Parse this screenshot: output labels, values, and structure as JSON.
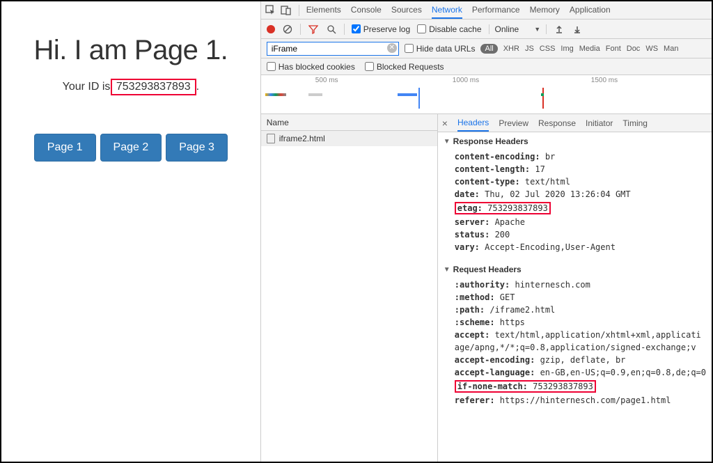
{
  "webpage": {
    "heading": "Hi. I am Page 1.",
    "id_label": "Your ID is ",
    "id_value": "753293837893",
    "id_suffix": ".",
    "buttons": [
      "Page 1",
      "Page 2",
      "Page 3"
    ]
  },
  "devtools": {
    "top_tabs": [
      "Elements",
      "Console",
      "Sources",
      "Network",
      "Performance",
      "Memory",
      "Application"
    ],
    "top_active": "Network",
    "toolbar": {
      "preserve_log": "Preserve log",
      "disable_cache": "Disable cache",
      "throttling": "Online"
    },
    "filter": {
      "value": "iFrame",
      "hide_data_urls": "Hide data URLs",
      "types": [
        "All",
        "XHR",
        "JS",
        "CSS",
        "Img",
        "Media",
        "Font",
        "Doc",
        "WS",
        "Man"
      ],
      "has_blocked": "Has blocked cookies",
      "blocked_req": "Blocked Requests"
    },
    "timeline": {
      "ticks": [
        "500 ms",
        "1000 ms",
        "1500 ms"
      ]
    },
    "list": {
      "col": "Name",
      "rows": [
        "iframe2.html"
      ]
    },
    "detail": {
      "tabs": [
        "Headers",
        "Preview",
        "Response",
        "Initiator",
        "Timing"
      ],
      "active": "Headers",
      "response_section": "Response Headers",
      "response_headers": [
        {
          "k": "content-encoding:",
          "v": "br"
        },
        {
          "k": "content-length:",
          "v": "17"
        },
        {
          "k": "content-type:",
          "v": "text/html"
        },
        {
          "k": "date:",
          "v": "Thu, 02 Jul 2020 13:26:04 GMT"
        },
        {
          "k": "etag:",
          "v": "753293837893",
          "hl": true
        },
        {
          "k": "server:",
          "v": "Apache"
        },
        {
          "k": "status:",
          "v": "200"
        },
        {
          "k": "vary:",
          "v": "Accept-Encoding,User-Agent"
        }
      ],
      "request_section": "Request Headers",
      "request_headers": [
        {
          "k": ":authority:",
          "v": "hinternesch.com"
        },
        {
          "k": ":method:",
          "v": "GET"
        },
        {
          "k": ":path:",
          "v": "/iframe2.html"
        },
        {
          "k": ":scheme:",
          "v": "https"
        },
        {
          "k": "accept:",
          "v": "text/html,application/xhtml+xml,applicati"
        },
        {
          "k": "",
          "v": "age/apng,*/*;q=0.8,application/signed-exchange;v"
        },
        {
          "k": "accept-encoding:",
          "v": "gzip, deflate, br"
        },
        {
          "k": "accept-language:",
          "v": "en-GB,en-US;q=0.9,en;q=0.8,de;q=0"
        },
        {
          "k": "if-none-match:",
          "v": "753293837893",
          "hl": true
        },
        {
          "k": "referer:",
          "v": "https://hinternesch.com/page1.html"
        }
      ]
    }
  }
}
